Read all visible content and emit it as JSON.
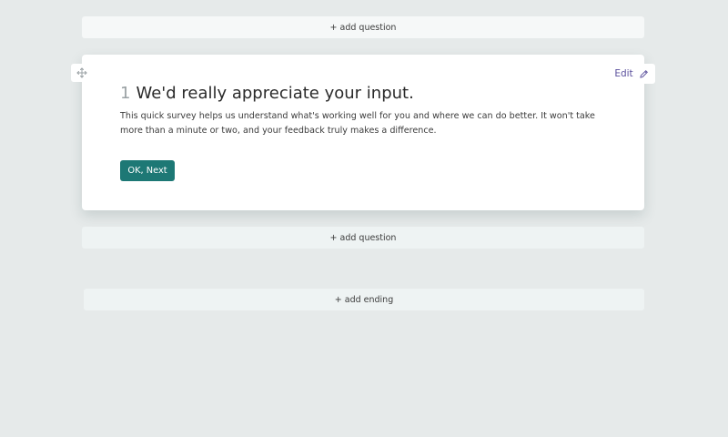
{
  "builder": {
    "add_question_label": "+ add question",
    "add_ending_label": "+ add ending"
  },
  "question": {
    "number": "1",
    "title": "We'd really appreciate your input.",
    "description": "This quick survey helps us understand what's working well for you and where we can do better. It won't take more than a minute or two, and your feedback truly makes a difference.",
    "button_label": "OK, Next",
    "edit_label": "Edit"
  },
  "icons": {
    "drag": "move-icon",
    "edit": "pencil-icon"
  },
  "colors": {
    "accent": "#1d7875",
    "edit_text": "#5a4f9c",
    "canvas": "#e6eaea"
  }
}
